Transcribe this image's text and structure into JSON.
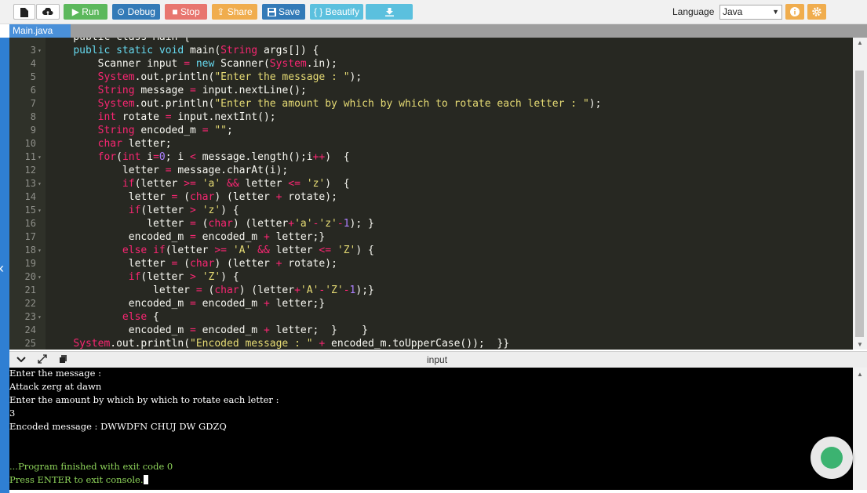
{
  "toolbar": {
    "run_label": "Run",
    "debug_label": "Debug",
    "stop_label": "Stop",
    "share_label": "Share",
    "save_label": "Save",
    "beautify_label": "{ } Beautify",
    "language_label": "Language",
    "language_value": "Java"
  },
  "tabs": {
    "active": "Main.java"
  },
  "editor": {
    "lines": [
      {
        "n": "",
        "fold": false,
        "parts": [
          {
            "t": "    public class Main {",
            "c": "plain"
          }
        ]
      },
      {
        "n": "3",
        "fold": true,
        "parts": [
          {
            "t": "    ",
            "c": "plain"
          },
          {
            "t": "public static void",
            "c": "kw"
          },
          {
            "t": " main(",
            "c": "plain"
          },
          {
            "t": "String",
            "c": "op"
          },
          {
            "t": " args[]) {",
            "c": "plain"
          }
        ]
      },
      {
        "n": "4",
        "fold": false,
        "parts": [
          {
            "t": "        Scanner input ",
            "c": "plain"
          },
          {
            "t": "=",
            "c": "op"
          },
          {
            "t": " ",
            "c": "plain"
          },
          {
            "t": "new",
            "c": "kw"
          },
          {
            "t": " Scanner(",
            "c": "plain"
          },
          {
            "t": "System",
            "c": "op"
          },
          {
            "t": ".in);",
            "c": "plain"
          }
        ]
      },
      {
        "n": "5",
        "fold": false,
        "parts": [
          {
            "t": "        ",
            "c": "plain"
          },
          {
            "t": "System",
            "c": "op"
          },
          {
            "t": ".out.println(",
            "c": "plain"
          },
          {
            "t": "\"Enter the message : \"",
            "c": "str"
          },
          {
            "t": ");",
            "c": "plain"
          }
        ]
      },
      {
        "n": "6",
        "fold": false,
        "parts": [
          {
            "t": "        ",
            "c": "plain"
          },
          {
            "t": "String",
            "c": "op"
          },
          {
            "t": " message ",
            "c": "plain"
          },
          {
            "t": "=",
            "c": "op"
          },
          {
            "t": " input.nextLine();",
            "c": "plain"
          }
        ]
      },
      {
        "n": "7",
        "fold": false,
        "parts": [
          {
            "t": "        ",
            "c": "plain"
          },
          {
            "t": "System",
            "c": "op"
          },
          {
            "t": ".out.println(",
            "c": "plain"
          },
          {
            "t": "\"Enter the amount by which by which to rotate each letter : \"",
            "c": "str"
          },
          {
            "t": ");",
            "c": "plain"
          }
        ]
      },
      {
        "n": "8",
        "fold": false,
        "parts": [
          {
            "t": "        ",
            "c": "plain"
          },
          {
            "t": "int",
            "c": "op"
          },
          {
            "t": " rotate ",
            "c": "plain"
          },
          {
            "t": "=",
            "c": "op"
          },
          {
            "t": " input.nextInt();",
            "c": "plain"
          }
        ]
      },
      {
        "n": "9",
        "fold": false,
        "parts": [
          {
            "t": "        ",
            "c": "plain"
          },
          {
            "t": "String",
            "c": "op"
          },
          {
            "t": " encoded_m ",
            "c": "plain"
          },
          {
            "t": "=",
            "c": "op"
          },
          {
            "t": " ",
            "c": "plain"
          },
          {
            "t": "\"\"",
            "c": "str"
          },
          {
            "t": ";",
            "c": "plain"
          }
        ]
      },
      {
        "n": "10",
        "fold": false,
        "parts": [
          {
            "t": "        ",
            "c": "plain"
          },
          {
            "t": "char",
            "c": "op"
          },
          {
            "t": " letter;",
            "c": "plain"
          }
        ]
      },
      {
        "n": "11",
        "fold": true,
        "parts": [
          {
            "t": "        ",
            "c": "plain"
          },
          {
            "t": "for",
            "c": "op"
          },
          {
            "t": "(",
            "c": "plain"
          },
          {
            "t": "int",
            "c": "op"
          },
          {
            "t": " i",
            "c": "plain"
          },
          {
            "t": "=",
            "c": "op"
          },
          {
            "t": "0",
            "c": "num"
          },
          {
            "t": "; i ",
            "c": "plain"
          },
          {
            "t": "<",
            "c": "op"
          },
          {
            "t": " message.length();i",
            "c": "plain"
          },
          {
            "t": "++",
            "c": "op"
          },
          {
            "t": ")  {",
            "c": "plain"
          }
        ]
      },
      {
        "n": "12",
        "fold": false,
        "parts": [
          {
            "t": "            letter ",
            "c": "plain"
          },
          {
            "t": "=",
            "c": "op"
          },
          {
            "t": " message.charAt(i);",
            "c": "plain"
          }
        ]
      },
      {
        "n": "13",
        "fold": true,
        "parts": [
          {
            "t": "            ",
            "c": "plain"
          },
          {
            "t": "if",
            "c": "op"
          },
          {
            "t": "(letter ",
            "c": "plain"
          },
          {
            "t": ">=",
            "c": "op"
          },
          {
            "t": " ",
            "c": "plain"
          },
          {
            "t": "'a'",
            "c": "str"
          },
          {
            "t": " ",
            "c": "plain"
          },
          {
            "t": "&&",
            "c": "op"
          },
          {
            "t": " letter ",
            "c": "plain"
          },
          {
            "t": "<=",
            "c": "op"
          },
          {
            "t": " ",
            "c": "plain"
          },
          {
            "t": "'z'",
            "c": "str"
          },
          {
            "t": ")  {",
            "c": "plain"
          }
        ]
      },
      {
        "n": "14",
        "fold": false,
        "parts": [
          {
            "t": "             letter ",
            "c": "plain"
          },
          {
            "t": "=",
            "c": "op"
          },
          {
            "t": " (",
            "c": "plain"
          },
          {
            "t": "char",
            "c": "op"
          },
          {
            "t": ") (letter ",
            "c": "plain"
          },
          {
            "t": "+",
            "c": "op"
          },
          {
            "t": " rotate);",
            "c": "plain"
          }
        ]
      },
      {
        "n": "15",
        "fold": true,
        "parts": [
          {
            "t": "             ",
            "c": "plain"
          },
          {
            "t": "if",
            "c": "op"
          },
          {
            "t": "(letter ",
            "c": "plain"
          },
          {
            "t": ">",
            "c": "op"
          },
          {
            "t": " ",
            "c": "plain"
          },
          {
            "t": "'z'",
            "c": "str"
          },
          {
            "t": ") {",
            "c": "plain"
          }
        ]
      },
      {
        "n": "16",
        "fold": false,
        "parts": [
          {
            "t": "                letter ",
            "c": "plain"
          },
          {
            "t": "=",
            "c": "op"
          },
          {
            "t": " (",
            "c": "plain"
          },
          {
            "t": "char",
            "c": "op"
          },
          {
            "t": ") (letter",
            "c": "plain"
          },
          {
            "t": "+",
            "c": "op"
          },
          {
            "t": "'a'",
            "c": "str"
          },
          {
            "t": "-",
            "c": "op"
          },
          {
            "t": "'z'",
            "c": "str"
          },
          {
            "t": "-",
            "c": "op"
          },
          {
            "t": "1",
            "c": "num"
          },
          {
            "t": "); }",
            "c": "plain"
          }
        ]
      },
      {
        "n": "17",
        "fold": false,
        "parts": [
          {
            "t": "             encoded_m ",
            "c": "plain"
          },
          {
            "t": "=",
            "c": "op"
          },
          {
            "t": " encoded_m ",
            "c": "plain"
          },
          {
            "t": "+",
            "c": "op"
          },
          {
            "t": " letter;}",
            "c": "plain"
          }
        ]
      },
      {
        "n": "18",
        "fold": true,
        "parts": [
          {
            "t": "            ",
            "c": "plain"
          },
          {
            "t": "else if",
            "c": "op"
          },
          {
            "t": "(letter ",
            "c": "plain"
          },
          {
            "t": ">=",
            "c": "op"
          },
          {
            "t": " ",
            "c": "plain"
          },
          {
            "t": "'A'",
            "c": "str"
          },
          {
            "t": " ",
            "c": "plain"
          },
          {
            "t": "&&",
            "c": "op"
          },
          {
            "t": " letter ",
            "c": "plain"
          },
          {
            "t": "<=",
            "c": "op"
          },
          {
            "t": " ",
            "c": "plain"
          },
          {
            "t": "'Z'",
            "c": "str"
          },
          {
            "t": ") {",
            "c": "plain"
          }
        ]
      },
      {
        "n": "19",
        "fold": false,
        "parts": [
          {
            "t": "             letter ",
            "c": "plain"
          },
          {
            "t": "=",
            "c": "op"
          },
          {
            "t": " (",
            "c": "plain"
          },
          {
            "t": "char",
            "c": "op"
          },
          {
            "t": ") (letter ",
            "c": "plain"
          },
          {
            "t": "+",
            "c": "op"
          },
          {
            "t": " rotate);",
            "c": "plain"
          }
        ]
      },
      {
        "n": "20",
        "fold": true,
        "parts": [
          {
            "t": "             ",
            "c": "plain"
          },
          {
            "t": "if",
            "c": "op"
          },
          {
            "t": "(letter ",
            "c": "plain"
          },
          {
            "t": ">",
            "c": "op"
          },
          {
            "t": " ",
            "c": "plain"
          },
          {
            "t": "'Z'",
            "c": "str"
          },
          {
            "t": ") {",
            "c": "plain"
          }
        ]
      },
      {
        "n": "21",
        "fold": false,
        "parts": [
          {
            "t": "                 letter ",
            "c": "plain"
          },
          {
            "t": "=",
            "c": "op"
          },
          {
            "t": " (",
            "c": "plain"
          },
          {
            "t": "char",
            "c": "op"
          },
          {
            "t": ") (letter",
            "c": "plain"
          },
          {
            "t": "+",
            "c": "op"
          },
          {
            "t": "'A'",
            "c": "str"
          },
          {
            "t": "-",
            "c": "op"
          },
          {
            "t": "'Z'",
            "c": "str"
          },
          {
            "t": "-",
            "c": "op"
          },
          {
            "t": "1",
            "c": "num"
          },
          {
            "t": ");}",
            "c": "plain"
          }
        ]
      },
      {
        "n": "22",
        "fold": false,
        "parts": [
          {
            "t": "             encoded_m ",
            "c": "plain"
          },
          {
            "t": "=",
            "c": "op"
          },
          {
            "t": " encoded_m ",
            "c": "plain"
          },
          {
            "t": "+",
            "c": "op"
          },
          {
            "t": " letter;}",
            "c": "plain"
          }
        ]
      },
      {
        "n": "23",
        "fold": true,
        "parts": [
          {
            "t": "            ",
            "c": "plain"
          },
          {
            "t": "else",
            "c": "op"
          },
          {
            "t": " {",
            "c": "plain"
          }
        ]
      },
      {
        "n": "24",
        "fold": false,
        "parts": [
          {
            "t": "             encoded_m ",
            "c": "plain"
          },
          {
            "t": "=",
            "c": "op"
          },
          {
            "t": " encoded_m ",
            "c": "plain"
          },
          {
            "t": "+",
            "c": "op"
          },
          {
            "t": " letter;  }    }",
            "c": "plain"
          }
        ]
      },
      {
        "n": "25",
        "fold": false,
        "parts": [
          {
            "t": "    ",
            "c": "plain"
          },
          {
            "t": "System",
            "c": "op"
          },
          {
            "t": ".out.println(",
            "c": "plain"
          },
          {
            "t": "\"Encoded message : \"",
            "c": "str"
          },
          {
            "t": " ",
            "c": "plain"
          },
          {
            "t": "+",
            "c": "op"
          },
          {
            "t": " encoded_m.toUpperCase());  }}",
            "c": "plain"
          }
        ]
      }
    ]
  },
  "console": {
    "title": "input",
    "lines": [
      {
        "text": "Enter the message :",
        "green": false
      },
      {
        "text": "Attack zerg at dawn",
        "green": false
      },
      {
        "text": "Enter the amount by which by which to rotate each letter :",
        "green": false
      },
      {
        "text": "3",
        "green": false
      },
      {
        "text": "Encoded message : DWWDFN CHUJ DW GDZQ",
        "green": false
      },
      {
        "text": "",
        "green": false
      },
      {
        "text": "",
        "green": false
      },
      {
        "text": "...Program finished with exit code 0",
        "green": true
      },
      {
        "text": "Press ENTER to exit console.",
        "green": true
      }
    ]
  }
}
